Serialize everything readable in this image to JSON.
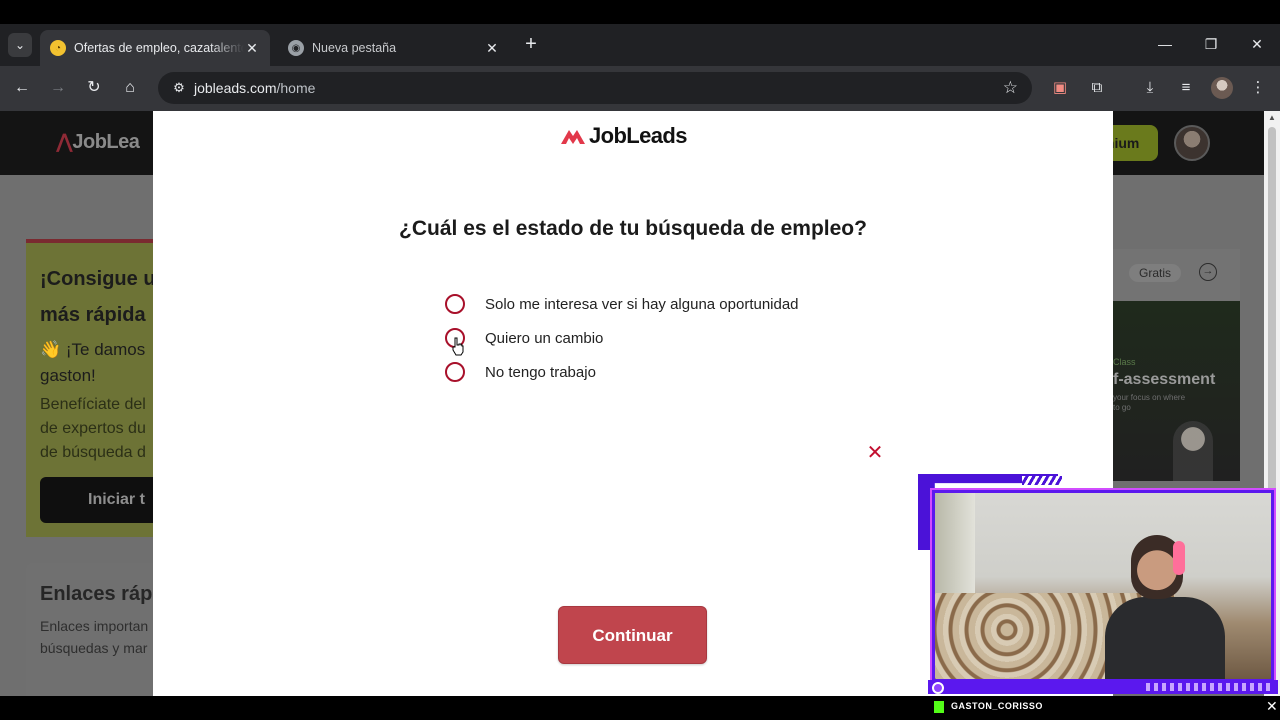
{
  "browser": {
    "tabs": [
      {
        "title": "Ofertas de empleo, cazatalentos",
        "active": true,
        "favicon": "jobleads-favicon"
      },
      {
        "title": "Nueva pestaña",
        "active": false,
        "favicon": "chrome-favicon"
      }
    ],
    "url_host": "jobleads.com",
    "url_path": "/home"
  },
  "background_page": {
    "logo": "JobLea",
    "premium_label": "mium",
    "promo_heading_line1": "¡Consigue u",
    "promo_heading_line2": "más rápida",
    "promo_text_line1": "👋 ¡Te damos",
    "promo_text_line2": "gaston!",
    "promo_sub_line1": "Benefíciate del",
    "promo_sub_line2": "de expertos du",
    "promo_sub_line3": "de búsqueda d",
    "promo_button": "Iniciar t",
    "links_heading": "Enlaces ráp",
    "links_text_line1": "Enlaces importan",
    "links_text_line2": "búsquedas y mar",
    "right_badge": "Gratis",
    "masterclass_kicker": "Class",
    "masterclass_title": "f-assessment",
    "masterclass_sub_line1": "your focus on where",
    "masterclass_sub_line2": "to go"
  },
  "modal": {
    "logo": "JobLeads",
    "question": "¿Cuál es el estado de tu búsqueda de empleo?",
    "options": [
      {
        "label": "Solo me interesa ver si hay alguna oportunidad",
        "selected": false
      },
      {
        "label": "Quiero un cambio",
        "selected": false
      },
      {
        "label": "No tengo trabajo",
        "selected": false
      }
    ],
    "continue_label": "Continuar",
    "accent_color": "#c0454d",
    "radio_color": "#a8102a"
  },
  "overlay": {
    "streamer_name": "GASTON_CORISSO"
  }
}
